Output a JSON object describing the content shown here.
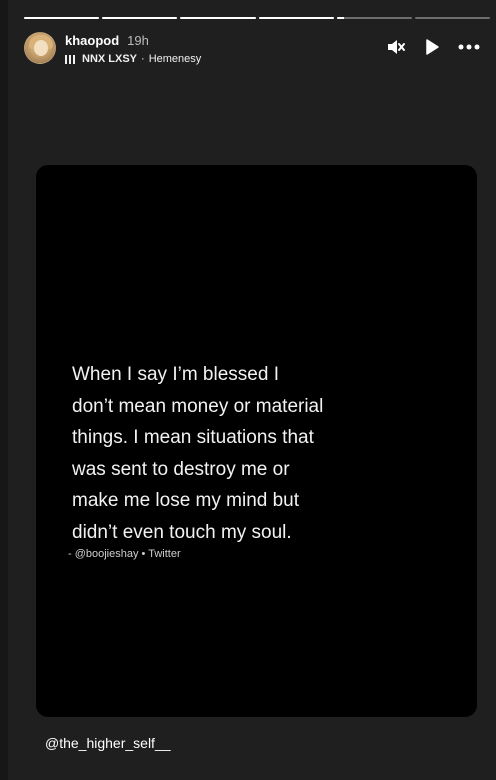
{
  "story": {
    "segments": [
      {
        "progress": 1.0
      },
      {
        "progress": 1.0
      },
      {
        "progress": 1.0
      },
      {
        "progress": 1.0
      },
      {
        "progress": 0.1
      },
      {
        "progress": 0.0
      }
    ]
  },
  "header": {
    "username": "khaopod",
    "time": "19h",
    "music": {
      "artist": "NNX LXSY",
      "separator": "·",
      "track": "Hemenesy"
    }
  },
  "controls": {
    "mute_icon": "speaker-muted-icon",
    "play_icon": "play-icon",
    "more_icon": "more-horizontal-icon"
  },
  "card": {
    "quote_lines": [
      "When I say I’m blessed I",
      "don’t mean money or material",
      "things. I mean situations that",
      "was sent to destroy me or",
      "make me lose my mind but",
      "didn’t even touch my soul."
    ],
    "attribution": "- @boojieshay • Twitter"
  },
  "caption": "@the_higher_self__",
  "colors": {
    "background": "#1f1f1f",
    "card": "#000000",
    "text": "#ffffff"
  }
}
